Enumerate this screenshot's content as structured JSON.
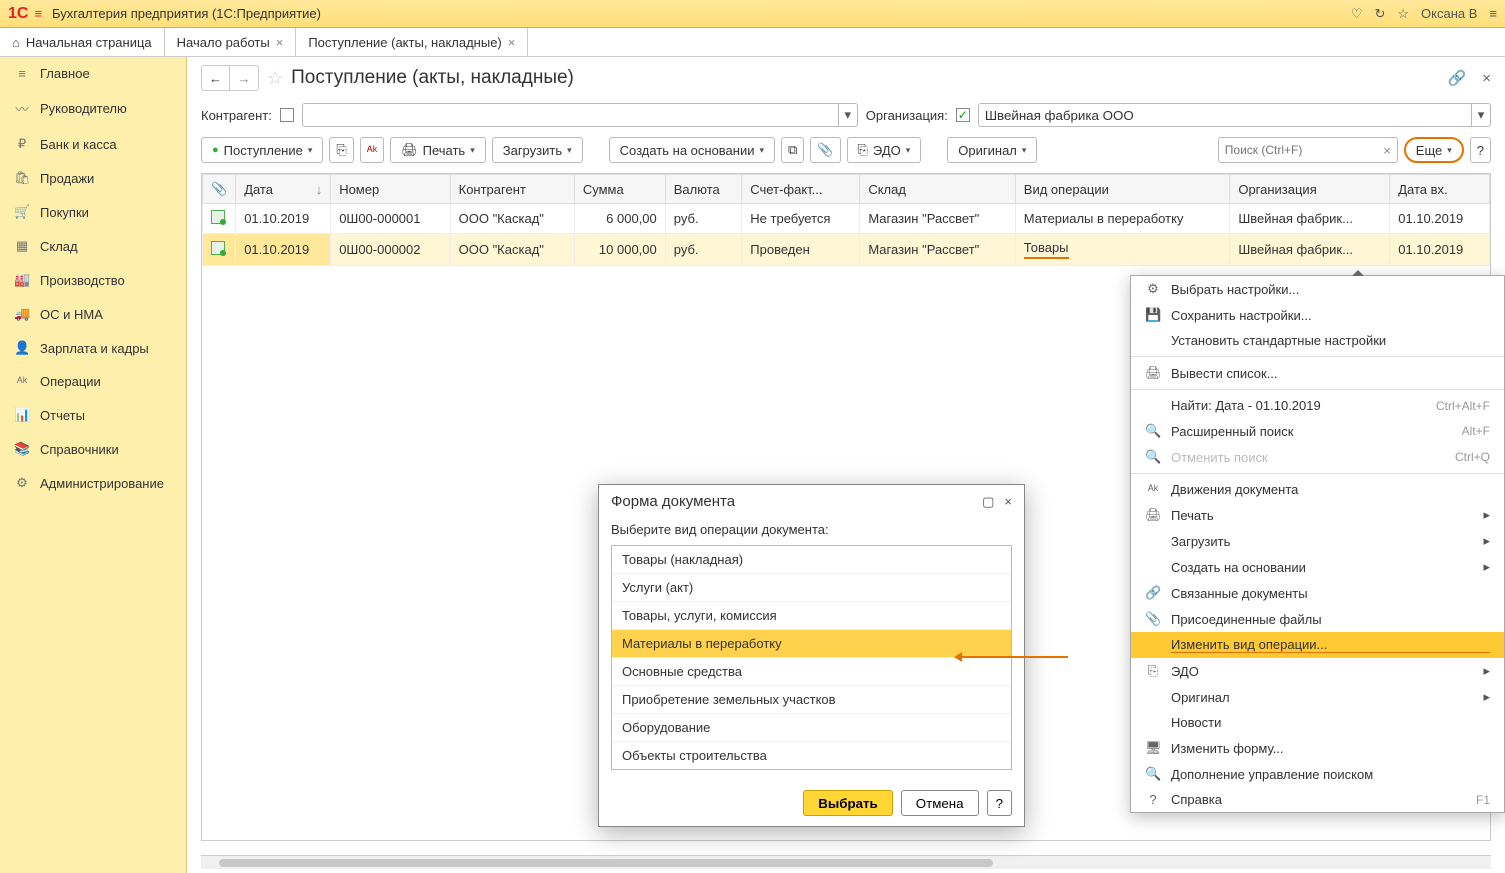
{
  "titlebar": {
    "app_title": "Бухгалтерия предприятия  (1С:Предприятие)",
    "username": "Оксана В"
  },
  "tabs": {
    "home": "Начальная страница",
    "t1": "Начало работы",
    "t2": "Поступление (акты, накладные)"
  },
  "sidebar": {
    "items": [
      {
        "icon": "≡",
        "label": "Главное"
      },
      {
        "icon": "〰",
        "label": "Руководителю"
      },
      {
        "icon": "₽",
        "label": "Банк и касса"
      },
      {
        "icon": "🛍",
        "label": "Продажи"
      },
      {
        "icon": "🛒",
        "label": "Покупки"
      },
      {
        "icon": "▦",
        "label": "Склад"
      },
      {
        "icon": "🏭",
        "label": "Производство"
      },
      {
        "icon": "🚚",
        "label": "ОС и НМА"
      },
      {
        "icon": "👤",
        "label": "Зарплата и кадры"
      },
      {
        "icon": "ᴬᵏ",
        "label": "Операции"
      },
      {
        "icon": "📊",
        "label": "Отчеты"
      },
      {
        "icon": "📚",
        "label": "Справочники"
      },
      {
        "icon": "⚙",
        "label": "Администрирование"
      }
    ]
  },
  "page": {
    "title": "Поступление (акты, накладные)"
  },
  "filter": {
    "label_contractor": "Контрагент:",
    "label_org": "Организация:",
    "org_value": "Швейная фабрика ООО"
  },
  "toolbar": {
    "create": "Поступление",
    "print": "Печать",
    "load": "Загрузить",
    "create_based": "Создать на основании",
    "edo": "ЭДО",
    "original": "Оригинал",
    "search_ph": "Поиск (Ctrl+F)",
    "more": "Еще",
    "help": "?"
  },
  "table": {
    "headers": [
      "",
      "Дата",
      "Номер",
      "Контрагент",
      "Сумма",
      "Валюта",
      "Счет-факт...",
      "Склад",
      "Вид операции",
      "Организация",
      "Дата вх."
    ],
    "rows": [
      {
        "date": "01.10.2019",
        "num": "0Ш00-000001",
        "contr": "ООО \"Каскад\"",
        "sum": "6 000,00",
        "cur": "руб.",
        "sf": "Не требуется",
        "wh": "Магазин \"Рассвет\"",
        "op": "Материалы в переработку",
        "org": "Швейная фабрик...",
        "din": "01.10.2019"
      },
      {
        "date": "01.10.2019",
        "num": "0Ш00-000002",
        "contr": "ООО \"Каскад\"",
        "sum": "10 000,00",
        "cur": "руб.",
        "sf": "Проведен",
        "wh": "Магазин \"Рассвет\"",
        "op": "Товары",
        "org": "Швейная фабрик...",
        "din": "01.10.2019"
      }
    ]
  },
  "context_menu": {
    "items": [
      {
        "icon": "⚙",
        "text": "Выбрать настройки..."
      },
      {
        "icon": "💾",
        "text": "Сохранить настройки..."
      },
      {
        "icon": "",
        "text": "Установить стандартные настройки"
      },
      {
        "sep": true
      },
      {
        "icon": "🖨",
        "text": "Вывести список..."
      },
      {
        "sep": true
      },
      {
        "icon": "",
        "text": "Найти: Дата - 01.10.2019",
        "shortcut": "Ctrl+Alt+F"
      },
      {
        "icon": "🔍",
        "text": "Расширенный поиск",
        "shortcut": "Alt+F"
      },
      {
        "icon": "🔍",
        "text": "Отменить поиск",
        "shortcut": "Ctrl+Q",
        "disabled": true
      },
      {
        "sep": true
      },
      {
        "icon": "ᴬᵏ",
        "text": "Движения документа"
      },
      {
        "icon": "🖨",
        "text": "Печать",
        "sub": true
      },
      {
        "icon": "",
        "text": "Загрузить",
        "sub": true
      },
      {
        "icon": "",
        "text": "Создать на основании",
        "sub": true
      },
      {
        "icon": "🔗",
        "text": "Связанные документы"
      },
      {
        "icon": "📎",
        "text": "Присоединенные файлы"
      },
      {
        "icon": "",
        "text": "Изменить вид операции...",
        "highlight": true
      },
      {
        "icon": "⎘",
        "text": "ЭДО",
        "sub": true
      },
      {
        "icon": "",
        "text": "Оригинал",
        "sub": true
      },
      {
        "icon": "",
        "text": "Новости"
      },
      {
        "icon": "🖥",
        "text": "Изменить форму..."
      },
      {
        "icon": "🔍",
        "text": "Дополнение управление поиском"
      },
      {
        "icon": "?",
        "text": "Справка",
        "shortcut": "F1"
      }
    ]
  },
  "dialog": {
    "title": "Форма документа",
    "label": "Выберите вид операции документа:",
    "items": [
      "Товары (накладная)",
      "Услуги (акт)",
      "Товары, услуги, комиссия",
      "Материалы в переработку",
      "Основные средства",
      "Приобретение земельных участков",
      "Оборудование",
      "Объекты строительства"
    ],
    "selected": 3,
    "ok": "Выбрать",
    "cancel": "Отмена",
    "help": "?"
  }
}
